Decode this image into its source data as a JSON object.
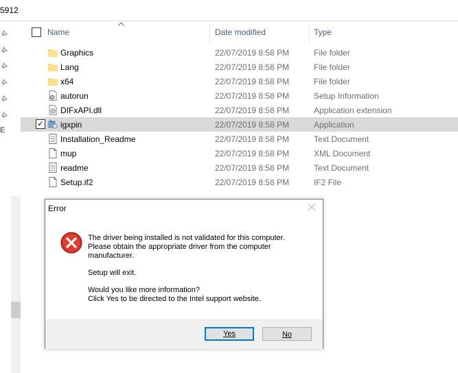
{
  "address_bar": {
    "text": "5912"
  },
  "columns": {
    "name": "Name",
    "date_modified": "Date modified",
    "type": "Type"
  },
  "files": [
    {
      "name": "Graphics",
      "date": "22/07/2019 8:58 PM",
      "type": "File folder",
      "icon": "folder-icon"
    },
    {
      "name": "Lang",
      "date": "22/07/2019 8:58 PM",
      "type": "File folder",
      "icon": "folder-icon"
    },
    {
      "name": "x64",
      "date": "22/07/2019 8:58 PM",
      "type": "File folder",
      "icon": "folder-icon"
    },
    {
      "name": "autorun",
      "date": "22/07/2019 8:58 PM",
      "type": "Setup Information",
      "icon": "settings-file-icon"
    },
    {
      "name": "DIFxAPI.dll",
      "date": "22/07/2019 8:58 PM",
      "type": "Application extension",
      "icon": "dll-file-icon"
    },
    {
      "name": "igxpin",
      "date": "22/07/2019 8:58 PM",
      "type": "Application",
      "icon": "installer-icon",
      "selected": true
    },
    {
      "name": "Installation_Readme",
      "date": "22/07/2019 8:58 PM",
      "type": "Text Document",
      "icon": "text-file-icon"
    },
    {
      "name": "mup",
      "date": "22/07/2019 8:58 PM",
      "type": "XML Document",
      "icon": "file-icon"
    },
    {
      "name": "readme",
      "date": "22/07/2019 8:58 PM",
      "type": "Text Document",
      "icon": "text-file-icon"
    },
    {
      "name": "Setup.if2",
      "date": "22/07/2019 8:58 PM",
      "type": "IF2 File",
      "icon": "file-icon"
    }
  ],
  "nav_pane": {
    "letter": "E"
  },
  "dialog": {
    "title": "Error",
    "message_line1": "The driver being installed is not validated for this computer.",
    "message_line2": "Please obtain the appropriate driver from the computer",
    "message_line3": "manufacturer.",
    "message_exit": "Setup will exit.",
    "message_question": "Would you like more information?",
    "message_click": "Click Yes to be directed to the Intel support website.",
    "yes_label": "Yes",
    "no_label": "No"
  },
  "colors": {
    "header_text": "#4c607a",
    "secondary_text": "#6d6d6d",
    "selection": "#d9d9d9",
    "error_red": "#d0131b",
    "focus_blue": "#0078d7"
  }
}
